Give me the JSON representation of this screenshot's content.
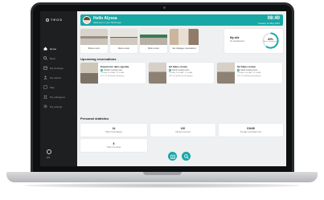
{
  "app": {
    "logo": "TEOS"
  },
  "sidebar": {
    "items": [
      {
        "label": "Home",
        "icon": "home-icon",
        "active": true
      },
      {
        "label": "Book",
        "icon": "search-icon",
        "active": false
      },
      {
        "label": "My bookings",
        "icon": "calendar-icon",
        "active": false
      },
      {
        "label": "My visitors",
        "icon": "visitors-icon",
        "active": false
      },
      {
        "label": "Map",
        "icon": "map-icon",
        "active": false
      },
      {
        "label": "My colleagues",
        "icon": "colleagues-icon",
        "active": false
      },
      {
        "label": "My settings",
        "icon": "gear-icon",
        "active": false
      }
    ],
    "bottom": {
      "label": "EN",
      "icon": "power-icon"
    }
  },
  "header": {
    "greeting": "Hello Alyssa",
    "subtitle": "Welcome to your TEOS app",
    "time": "08:40",
    "date": "Tuesday 10 May 2022"
  },
  "tiles": [
    {
      "label": "Book a room"
    },
    {
      "label": "Book a desk"
    },
    {
      "label": "Book a desk"
    },
    {
      "label": "Set colleague reservations"
    }
  ],
  "office": {
    "title": "My site",
    "location": "NL Headquarter",
    "occupancy_percent": 60,
    "occupancy_text": "60%",
    "occupancy_label": "Office occupancy rate"
  },
  "reservations": {
    "title": "Upcoming reservations",
    "items": [
      {
        "title": "Experience dans agenda",
        "status": "Tailspin meeting room",
        "date": "Tuesday 10:00 AM - 11:00 AM",
        "location": "NTC 1st 4th Break (Goodings)"
      },
      {
        "title": "Q4 Sales review",
        "status": "Quick meeting room",
        "date": "Tuesday 10:00 AM - 11:00 AM",
        "location": "NTC 1st 4th Break (Goodings)"
      },
      {
        "title": "Q4 Sales review",
        "status": "Quick meeting room",
        "date": "Tuesday 10:00 AM - 11:00 AM",
        "location": "NTC 1st 4th Break (Goodings)"
      }
    ]
  },
  "stats": {
    "title": "Personal statistics",
    "items": [
      {
        "value": "14",
        "label": "Total of reservations"
      },
      {
        "value": "120",
        "label": "Minutes reserved"
      },
      {
        "value": "01h36",
        "label": "Average reservation time"
      },
      {
        "value": "8",
        "label": "Total of no-show"
      }
    ]
  },
  "fabs": [
    {
      "icon": "calendar-add-icon"
    },
    {
      "icon": "search-icon"
    }
  ],
  "colors": {
    "accent": "#17a7a5",
    "sidebar": "#1e1f21",
    "background": "#eef0f1"
  }
}
